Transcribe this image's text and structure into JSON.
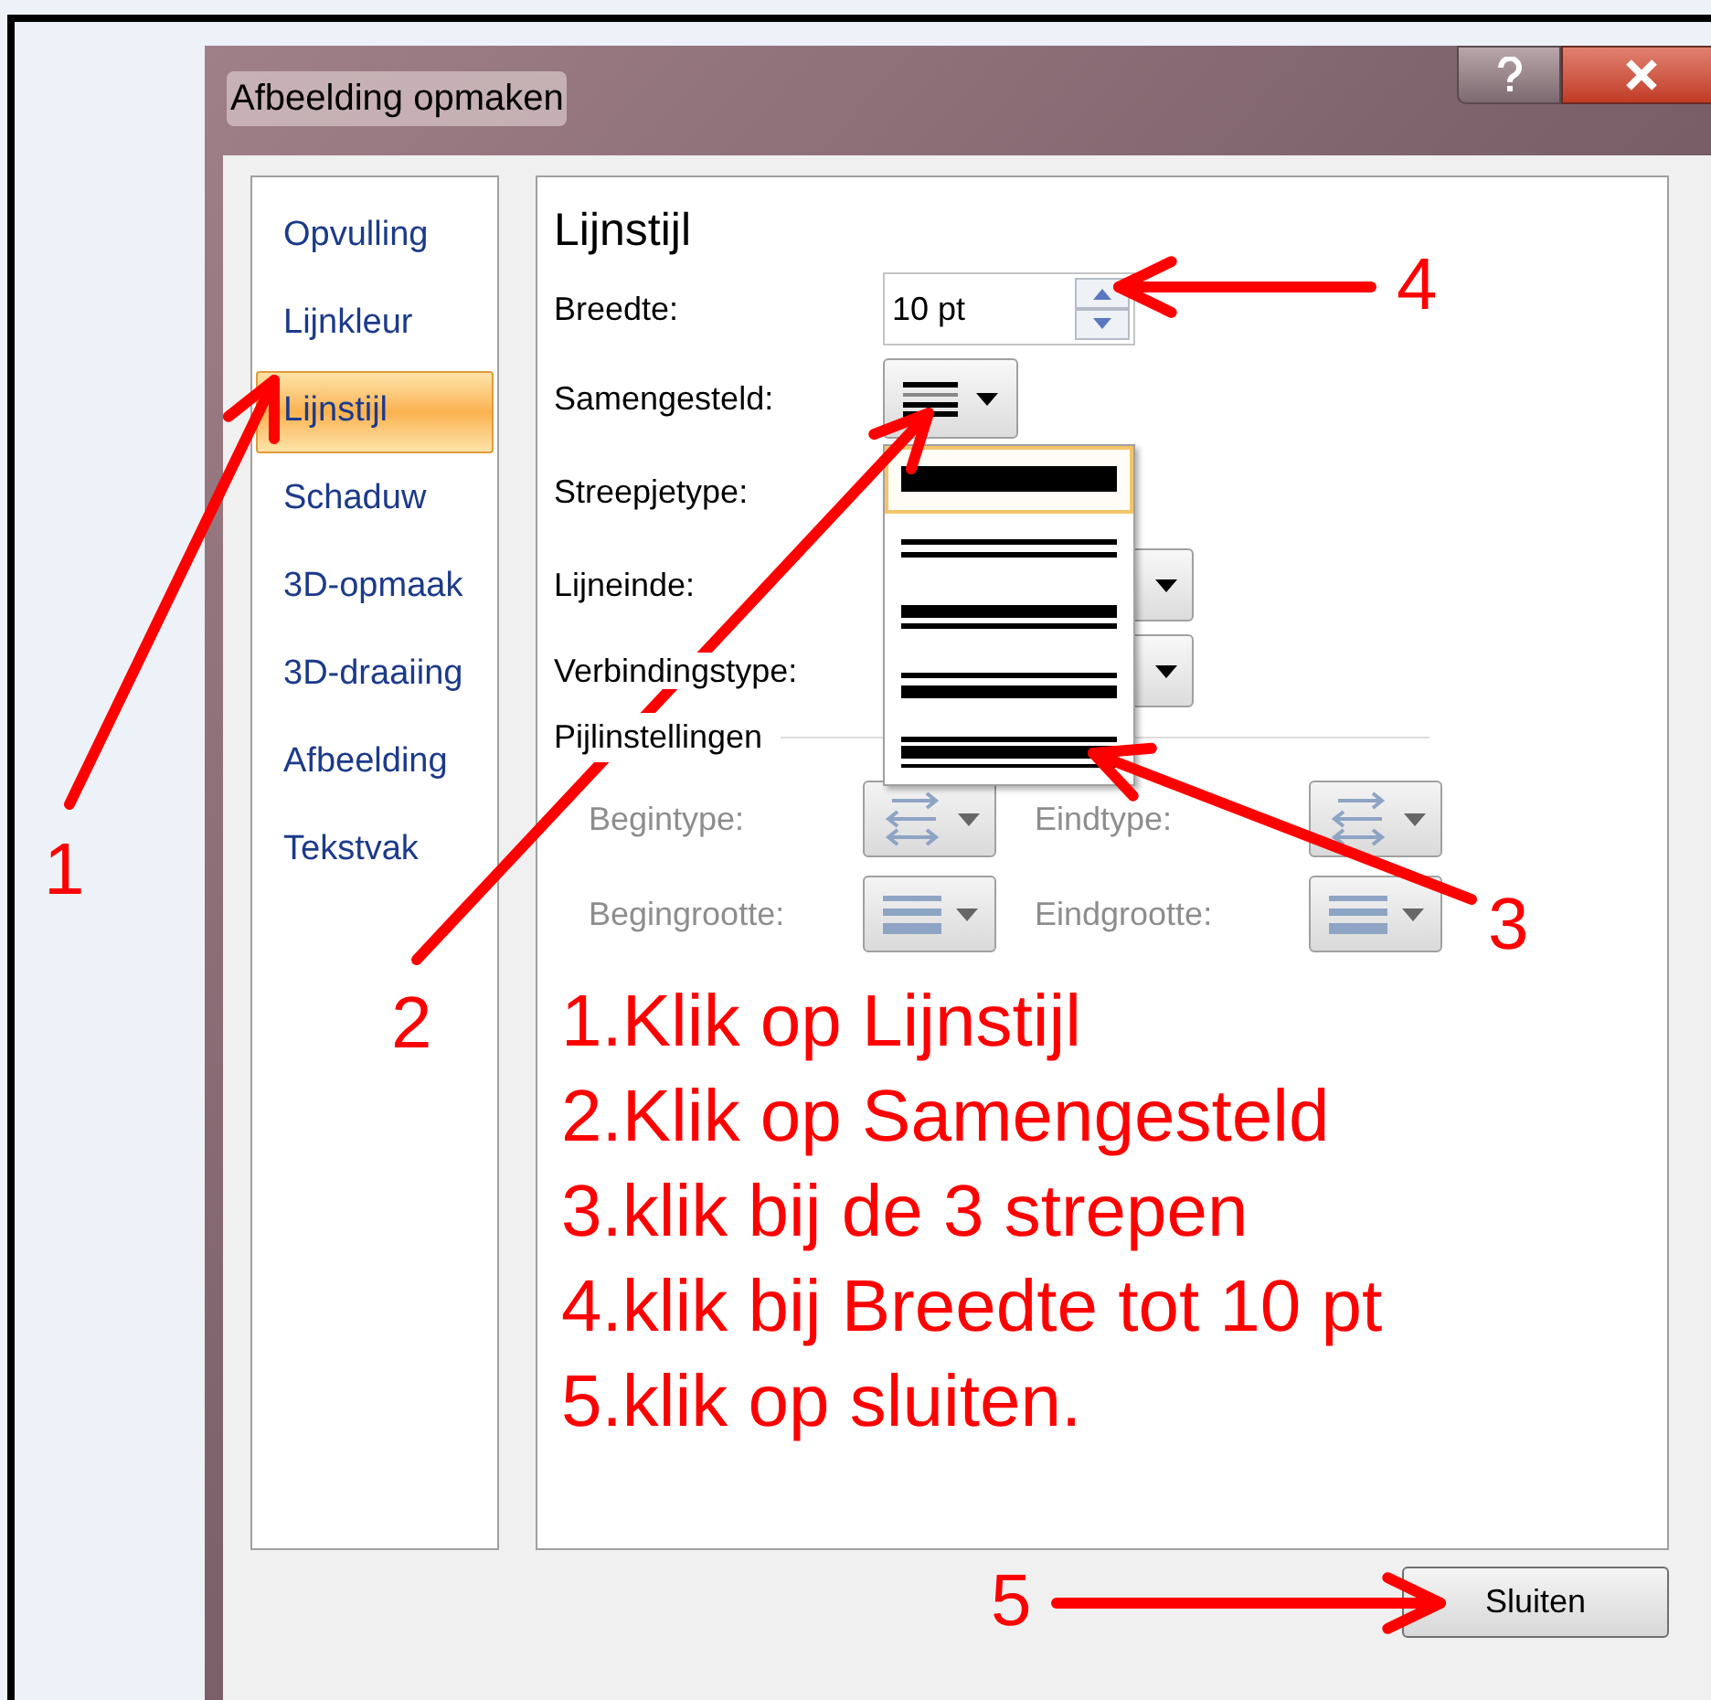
{
  "window": {
    "title": "Afbeelding opmaken"
  },
  "sidebar": {
    "items": [
      {
        "label": "Opvulling",
        "selected": false
      },
      {
        "label": "Lijnkleur",
        "selected": false
      },
      {
        "label": "Lijnstijl",
        "selected": true
      },
      {
        "label": "Schaduw",
        "selected": false
      },
      {
        "label": "3D-opmaak",
        "selected": false
      },
      {
        "label": "3D-draaiing",
        "selected": false
      },
      {
        "label": "Afbeelding",
        "selected": false
      },
      {
        "label": "Tekstvak",
        "selected": false
      }
    ]
  },
  "panel": {
    "title": "Lijnstijl",
    "fields": [
      {
        "kind": "spin",
        "label": "Breedte:",
        "value": "10 pt"
      },
      {
        "kind": "compound",
        "label": "Samengesteld:"
      },
      {
        "kind": "covered",
        "label": "Streepjetype:"
      },
      {
        "kind": "dropdown",
        "label": "Lijneinde:"
      },
      {
        "kind": "dropdown",
        "label": "Verbindingstype:"
      }
    ],
    "section": "Pijlinstellingen",
    "arrow_fields": [
      {
        "kind": "arrow",
        "label": "Begintype:",
        "disabled": true
      },
      {
        "kind": "arrow",
        "label": "Eindtype:",
        "disabled": true
      },
      {
        "kind": "size",
        "label": "Begingrootte:",
        "disabled": true
      },
      {
        "kind": "size",
        "label": "Eindgrootte:",
        "disabled": true
      }
    ],
    "compound_menu": [
      {
        "kind": "single",
        "selected": true
      },
      {
        "kind": "double",
        "selected": false
      },
      {
        "kind": "thick-thin",
        "selected": false
      },
      {
        "kind": "thin-thick",
        "selected": false
      },
      {
        "kind": "triple",
        "selected": false
      }
    ],
    "instructions": [
      "1.Klik op Lijnstijl",
      "2.Klik op Samengesteld",
      "3.klik bij de 3 strepen",
      "4.klik bij Breedte tot 10 pt",
      "5.klik op sluiten."
    ]
  },
  "footer": {
    "button": "Sluiten"
  },
  "annotations": [
    {
      "label": "1"
    },
    {
      "label": "2"
    },
    {
      "label": "3"
    },
    {
      "label": "4"
    },
    {
      "label": "5"
    }
  ]
}
